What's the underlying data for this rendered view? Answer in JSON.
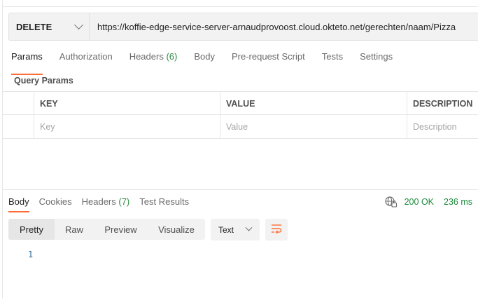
{
  "request": {
    "method": "DELETE",
    "url": "https://koffie-edge-service-server-arnaudprovoost.cloud.okteto.net/gerechten/naam/Pizza"
  },
  "request_tabs": [
    {
      "label": "Params",
      "active": true
    },
    {
      "label": "Authorization"
    },
    {
      "label": "Headers",
      "count": "(6)"
    },
    {
      "label": "Body"
    },
    {
      "label": "Pre-request Script"
    },
    {
      "label": "Tests"
    },
    {
      "label": "Settings"
    }
  ],
  "query_params": {
    "title": "Query Params",
    "columns": [
      "KEY",
      "VALUE",
      "DESCRIPTION"
    ],
    "placeholders": [
      "Key",
      "Value",
      "Description"
    ]
  },
  "response_tabs": [
    {
      "label": "Body",
      "active": true
    },
    {
      "label": "Cookies"
    },
    {
      "label": "Headers",
      "count": "(7)"
    },
    {
      "label": "Test Results"
    }
  ],
  "response_status": {
    "icon": "globe-lock-icon",
    "status": "200 OK",
    "time": "236 ms",
    "color": "#1c8a3d"
  },
  "body_views": [
    "Pretty",
    "Raw",
    "Preview",
    "Visualize"
  ],
  "body_format": "Text",
  "code_lines": [
    "1"
  ],
  "accent": "#ff6c37"
}
